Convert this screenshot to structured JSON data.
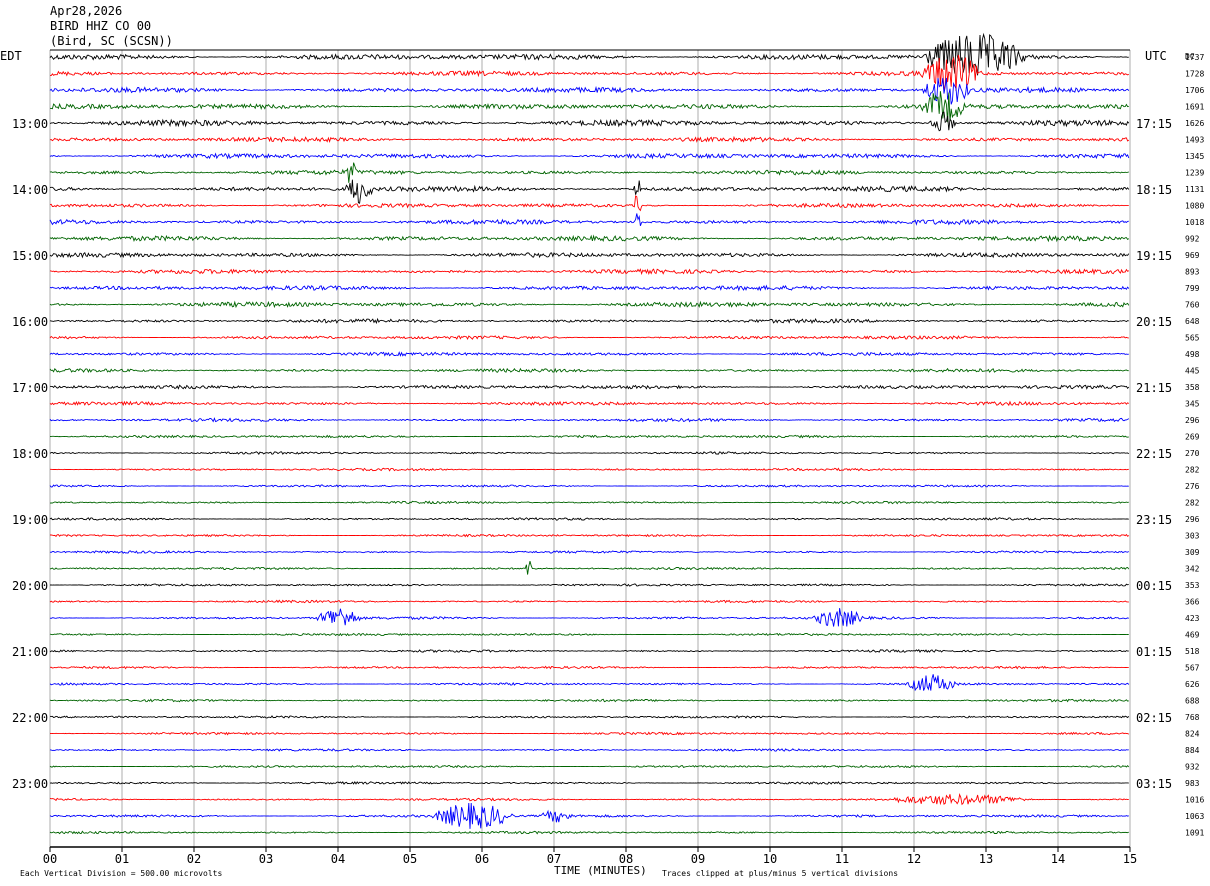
{
  "header": {
    "date": "Apr28,2026",
    "station": "BIRD HHZ CO 00",
    "location": "(Bird, SC (SCSN))"
  },
  "chart_data": {
    "type": "line",
    "title": "",
    "xlabel": "TIME (MINUTES)",
    "left_axis_label": "EDT",
    "right_axis_label": "UTC",
    "dc_label": "DC",
    "xlim": [
      0,
      15
    ],
    "x_ticks": [
      "00",
      "01",
      "02",
      "03",
      "04",
      "05",
      "06",
      "07",
      "08",
      "09",
      "10",
      "11",
      "12",
      "13",
      "14",
      "15"
    ],
    "grid": true,
    "series_colors": [
      "#000000",
      "#ff0000",
      "#0000ff",
      "#006400"
    ],
    "trace_count": 48,
    "left_hour_labels": [
      {
        "row": 4,
        "text": "13:00"
      },
      {
        "row": 8,
        "text": "14:00"
      },
      {
        "row": 12,
        "text": "15:00"
      },
      {
        "row": 16,
        "text": "16:00"
      },
      {
        "row": 20,
        "text": "17:00"
      },
      {
        "row": 24,
        "text": "18:00"
      },
      {
        "row": 28,
        "text": "19:00"
      },
      {
        "row": 32,
        "text": "20:00"
      },
      {
        "row": 36,
        "text": "21:00"
      },
      {
        "row": 40,
        "text": "22:00"
      },
      {
        "row": 44,
        "text": "23:00"
      }
    ],
    "right_hour_labels": [
      {
        "row": 4,
        "text": "17:15"
      },
      {
        "row": 8,
        "text": "18:15"
      },
      {
        "row": 12,
        "text": "19:15"
      },
      {
        "row": 16,
        "text": "20:15"
      },
      {
        "row": 20,
        "text": "21:15"
      },
      {
        "row": 24,
        "text": "22:15"
      },
      {
        "row": 28,
        "text": "23:15"
      },
      {
        "row": 32,
        "text": "00:15"
      },
      {
        "row": 36,
        "text": "01:15"
      },
      {
        "row": 40,
        "text": "02:15"
      },
      {
        "row": 44,
        "text": "03:15"
      }
    ],
    "dc_offsets": [
      1737,
      1728,
      1706,
      1691,
      1626,
      1493,
      1345,
      1239,
      1131,
      1080,
      1018,
      992,
      969,
      893,
      799,
      760,
      648,
      565,
      498,
      445,
      358,
      345,
      296,
      269,
      270,
      282,
      276,
      282,
      296,
      303,
      309,
      342,
      353,
      366,
      423,
      469,
      518,
      567,
      626,
      688,
      768,
      824,
      884,
      932,
      983,
      1016,
      1063,
      1091
    ],
    "noise_level": [
      1.6,
      1.2,
      1.3,
      1.4,
      1.5,
      1.2,
      1.3,
      1.2,
      1.4,
      1.1,
      1.2,
      1.3,
      1.2,
      1.1,
      1.2,
      1.3,
      1.0,
      0.9,
      0.9,
      0.9,
      1.0,
      0.9,
      0.8,
      0.7,
      0.6,
      0.6,
      0.6,
      0.6,
      0.6,
      0.6,
      0.6,
      0.6,
      0.6,
      0.6,
      0.7,
      0.6,
      0.6,
      0.6,
      0.6,
      0.6,
      0.6,
      0.6,
      0.6,
      0.6,
      0.6,
      0.6,
      0.7,
      0.6
    ],
    "events": [
      {
        "row": 0,
        "start_min": 12.1,
        "end_min": 14.0,
        "amp": 6
      },
      {
        "row": 1,
        "start_min": 12.1,
        "end_min": 13.2,
        "amp": 5
      },
      {
        "row": 2,
        "start_min": 12.1,
        "end_min": 13.0,
        "amp": 4
      },
      {
        "row": 3,
        "start_min": 12.1,
        "end_min": 12.9,
        "amp": 4
      },
      {
        "row": 4,
        "start_min": 12.2,
        "end_min": 12.7,
        "amp": 3
      },
      {
        "row": 7,
        "start_min": 4.1,
        "end_min": 4.3,
        "amp": 3
      },
      {
        "row": 8,
        "start_min": 4.1,
        "end_min": 4.6,
        "amp": 4
      },
      {
        "row": 8,
        "start_min": 8.1,
        "end_min": 8.25,
        "amp": 3
      },
      {
        "row": 9,
        "start_min": 8.1,
        "end_min": 8.25,
        "amp": 3
      },
      {
        "row": 10,
        "start_min": 8.1,
        "end_min": 8.25,
        "amp": 3
      },
      {
        "row": 31,
        "start_min": 6.6,
        "end_min": 6.75,
        "amp": 2.5
      },
      {
        "row": 34,
        "start_min": 3.7,
        "end_min": 4.5,
        "amp": 3
      },
      {
        "row": 34,
        "start_min": 10.6,
        "end_min": 11.5,
        "amp": 2.5
      },
      {
        "row": 38,
        "start_min": 11.9,
        "end_min": 12.8,
        "amp": 2.5
      },
      {
        "row": 45,
        "start_min": 11.6,
        "end_min": 14.3,
        "amp": 1.2
      },
      {
        "row": 46,
        "start_min": 5.3,
        "end_min": 6.8,
        "amp": 3.5
      },
      {
        "row": 46,
        "start_min": 6.8,
        "end_min": 7.4,
        "amp": 1.5
      }
    ]
  },
  "footer": {
    "vertical_division": "Each Vertical Division =  500.00 microvolts",
    "clipping": "Traces clipped at plus/minus 5 vertical divisions"
  }
}
